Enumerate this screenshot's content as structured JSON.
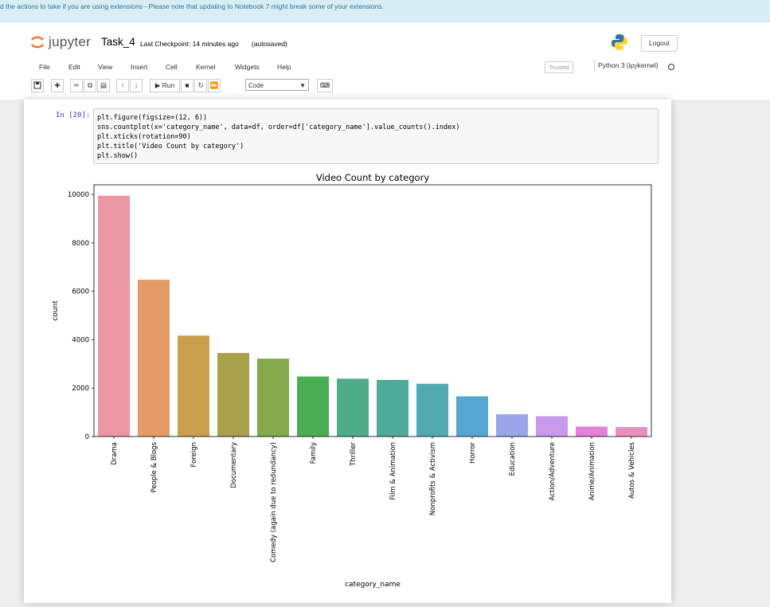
{
  "notice": "d the actions to take if you are using extensions - Please note that updating to Notebook 7 might break some of your extensions.",
  "header": {
    "logo_text": "jupyter",
    "notebook_name": "Task_4",
    "checkpoint": "Last Checkpoint: 14 minutes ago",
    "autosave": "(autosaved)",
    "logout": "Logout"
  },
  "menu": {
    "items": [
      "File",
      "Edit",
      "View",
      "Insert",
      "Cell",
      "Kernel",
      "Widgets",
      "Help"
    ],
    "trusted": "Trusted",
    "kernel": "Python 3 (ipykernel)"
  },
  "toolbar": {
    "run_label": "Run",
    "cell_type": "Code"
  },
  "cell": {
    "prompt": "In [20]:",
    "code": [
      "plt.figure(figsize=(12, 6))",
      "sns.countplot(x='category_name', data=df, order=df['category_name'].value_counts().index)",
      "plt.xticks(rotation=90)",
      "plt.title('Video Count by category')",
      "plt.show()"
    ]
  },
  "chart_data": {
    "type": "bar",
    "title": "Video Count by category",
    "xlabel": "category_name",
    "ylabel": "count",
    "ylim": [
      0,
      10400
    ],
    "yticks": [
      0,
      2000,
      4000,
      6000,
      8000,
      10000
    ],
    "categories": [
      "Drama",
      "People & Blogs",
      "Foreign",
      "Documentary",
      "Comedy (again due to redundancy)",
      "Family",
      "Thriller",
      "Film & Animation",
      "Nonprofits & Activism",
      "Horror",
      "Education",
      "Action/Adventure",
      "Anime/Animation",
      "Autos & Vehicles"
    ],
    "values": [
      9950,
      6480,
      4170,
      3450,
      3220,
      2480,
      2390,
      2340,
      2180,
      1660,
      920,
      840,
      410,
      390
    ],
    "colors": [
      "#ea96a3",
      "#e59b65",
      "#c99f4c",
      "#a8a04b",
      "#86a94c",
      "#4aae56",
      "#4eac8a",
      "#4fab9c",
      "#50aab0",
      "#55a6d0",
      "#9aa6ea",
      "#c89aeb",
      "#e67fd9",
      "#e98fc0"
    ],
    "grid": false,
    "legend": "none"
  }
}
